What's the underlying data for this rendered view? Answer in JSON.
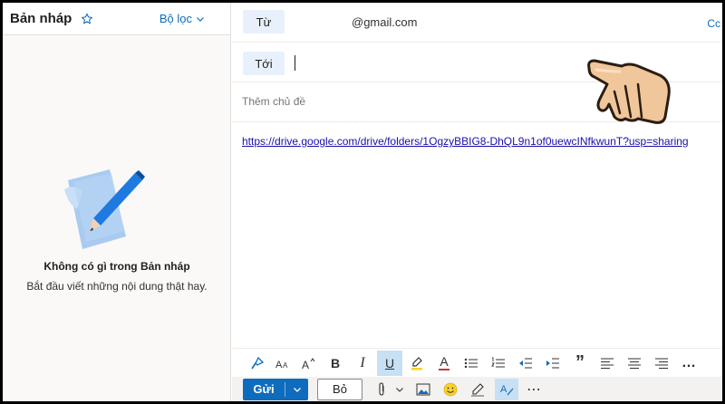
{
  "left": {
    "title": "Bản nháp",
    "filter_label": "Bộ lọc",
    "empty_title": "Không có gì trong Bản nháp",
    "empty_subtitle": "Bắt đầu viết những nội dung thật hay."
  },
  "compose": {
    "from_label": "Từ",
    "from_value": "@gmail.com",
    "cc_label": "Cc",
    "to_label": "Tới",
    "subject_placeholder": "Thêm chủ đề",
    "body_link": "https://drive.google.com/drive/folders/1OgzyBBIG8-DhQL9n1of0uewcINfkwunT?usp=sharing"
  },
  "format_toolbar": {
    "bold": "B",
    "italic": "I",
    "underline": "U",
    "font_color": "A",
    "quote": "”",
    "more": "…"
  },
  "actions": {
    "send_label": "Gửi",
    "discard_label": "Bỏ",
    "more": "⋯"
  },
  "colors": {
    "accent": "#0f6cbd",
    "link": "#1a0dab",
    "field_bg": "#e8f1fb",
    "active_tool": "#c7e0f4",
    "highlight_yellow": "#f8d22a",
    "font_color_red": "#d13438"
  },
  "icons": [
    "star-icon",
    "chevron-down-icon",
    "format-painter-icon",
    "font-size-icon",
    "grow-font-icon",
    "highlight-icon",
    "bullets-icon",
    "numbering-icon",
    "decrease-indent-icon",
    "increase-indent-icon",
    "align-left-icon",
    "align-center-icon",
    "align-right-icon",
    "attach-icon",
    "image-icon",
    "emoji-icon",
    "signature-icon",
    "editor-icon",
    "pointing-hand-icon",
    "draft-illustration-icon"
  ]
}
